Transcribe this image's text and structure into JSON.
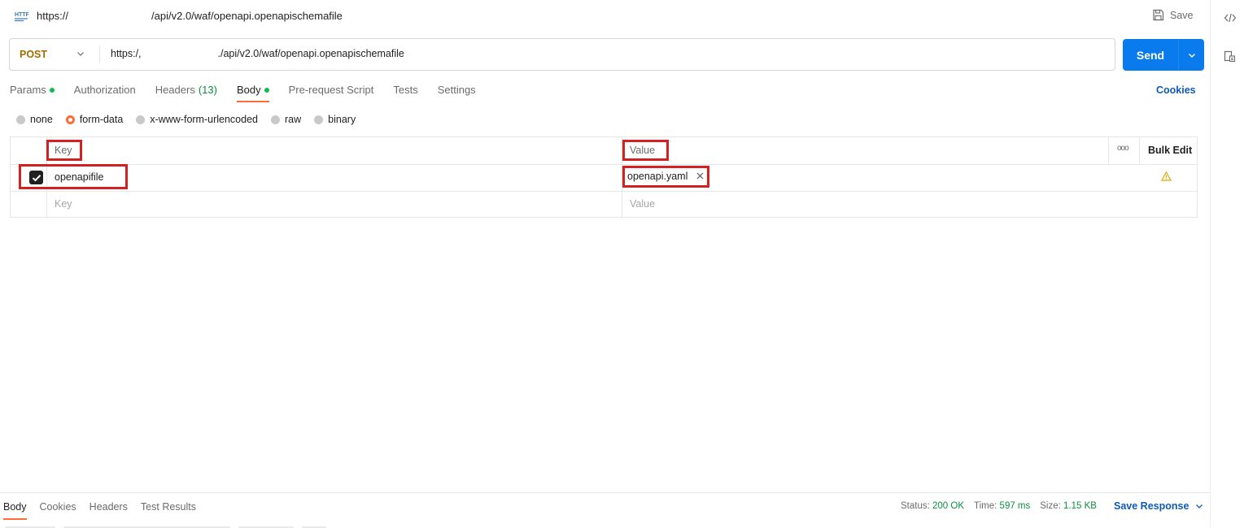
{
  "request": {
    "title_part1": "https://",
    "title_part2": "/api/v2.0/waf/openapi.openapischemafile",
    "save_label": "Save",
    "method": "POST",
    "url_part1": "https:/,",
    "url_part2": "./api/v2.0/waf/openapi.openapischemafile",
    "send_label": "Send"
  },
  "tabs": [
    {
      "label": "Params"
    },
    {
      "label": "Authorization"
    },
    {
      "label": "Headers",
      "count": "(13)"
    },
    {
      "label": "Body"
    },
    {
      "label": "Pre-request Script"
    },
    {
      "label": "Tests"
    },
    {
      "label": "Settings"
    }
  ],
  "cookies_label": "Cookies",
  "body_types": [
    "none",
    "form-data",
    "x-www-form-urlencoded",
    "raw",
    "binary"
  ],
  "table": {
    "key_header": "Key",
    "value_header": "Value",
    "more_label": "ooo",
    "bulk_edit": "Bulk Edit",
    "row_key": "openapifile",
    "row_value": "openapi.yaml",
    "key_placeholder": "Key",
    "value_placeholder": "Value"
  },
  "response": {
    "tabs": [
      "Body",
      "Cookies",
      "Headers",
      "Test Results"
    ],
    "status_label": "Status:",
    "status_value": "200 OK",
    "time_label": "Time:",
    "time_value": "597 ms",
    "size_label": "Size:",
    "size_value": "1.15 KB",
    "save_response": "Save Response"
  },
  "colors": {
    "accent": "#ff6c37",
    "send_button": "#097bed",
    "link": "#0f5ab8",
    "success": "#0a8f3d",
    "method": "#a66a00",
    "highlight": "#d32121",
    "warning": "#e0a800"
  },
  "icons": [
    "http-icon",
    "save-icon",
    "code-icon",
    "docs-icon",
    "chevron-down-icon",
    "close-icon",
    "warning-icon",
    "check-icon"
  ]
}
